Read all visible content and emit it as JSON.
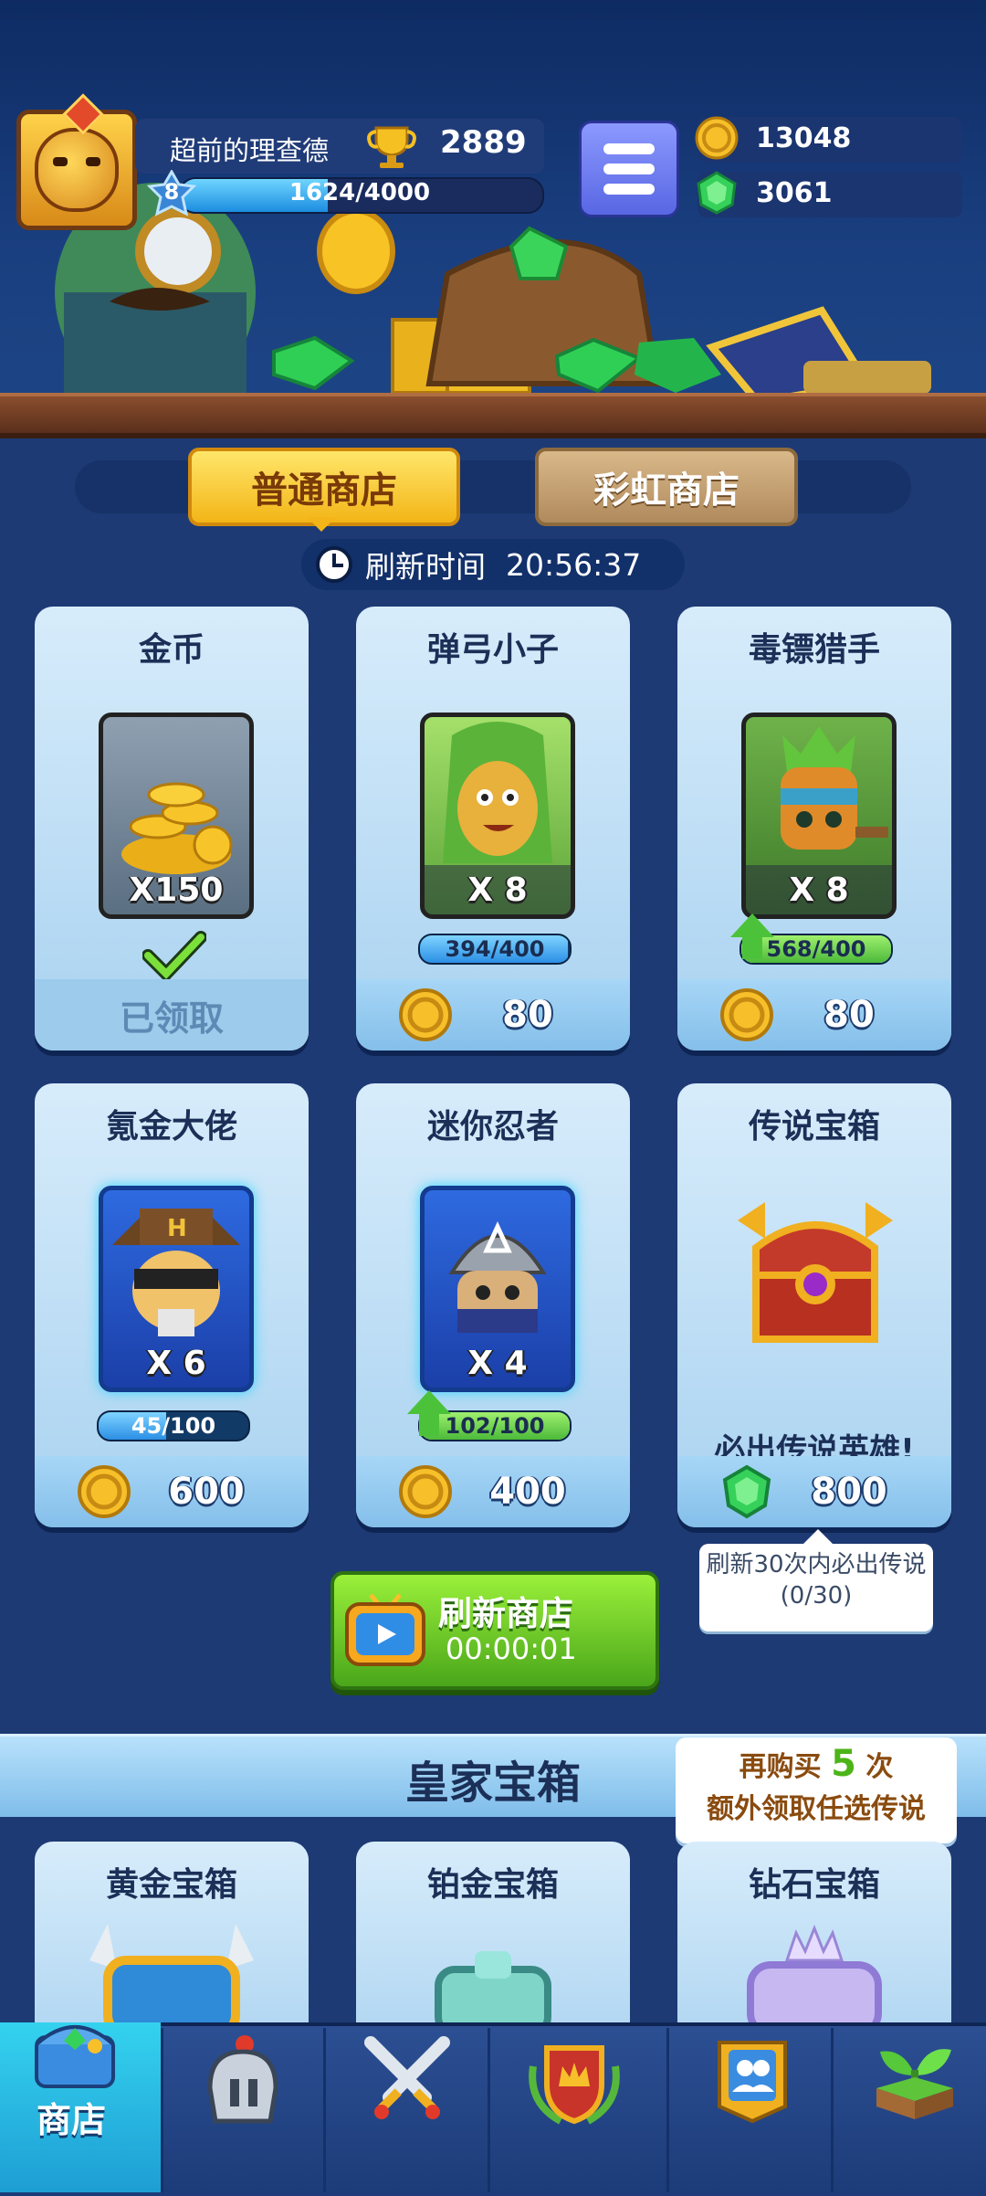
{
  "player": {
    "name": "超前的理查德",
    "trophies": "2889",
    "level": "8",
    "xp_text": "1624/4000",
    "xp_fraction": 0.406
  },
  "currency": {
    "gold": "13048",
    "gems": "3061"
  },
  "tabs": {
    "normal_shop": "普通商店",
    "rainbow_shop": "彩虹商店"
  },
  "refresh": {
    "label": "刷新时间",
    "time": "20:56:37"
  },
  "cards": [
    {
      "title": "金币",
      "qty": "X150",
      "status": "已领取"
    },
    {
      "title": "弹弓小子",
      "qty": "X 8",
      "progress": "394/400",
      "progress_fraction": 0.985,
      "price": "80"
    },
    {
      "title": "毒镖猎手",
      "qty": "X 8",
      "progress": "568/400",
      "progress_fraction": 1.0,
      "price": "80"
    },
    {
      "title": "氪金大佬",
      "qty": "X 6",
      "progress": "45/100",
      "progress_fraction": 0.45,
      "price": "600"
    },
    {
      "title": "迷你忍者",
      "qty": "X 4",
      "progress": "102/100",
      "progress_fraction": 1.0,
      "price": "400"
    },
    {
      "title": "传说宝箱",
      "note": "必出传说英雄!",
      "price": "800"
    }
  ],
  "tooltip": {
    "line1": "刷新30次内必出传说",
    "line2": "(0/30)"
  },
  "refresh_shop": {
    "label": "刷新商店",
    "timer": "00:00:01"
  },
  "royal": {
    "title": "皇家宝箱",
    "bonus_line1_a": "再购买",
    "bonus_count": "5",
    "bonus_line1_b": "次",
    "bonus_line2": "额外领取任选传说",
    "chests": [
      "黄金宝箱",
      "铂金宝箱",
      "钻石宝箱"
    ]
  },
  "nav": {
    "shop": "商店",
    "icons": [
      "shop-chest-icon",
      "knight-helmet-icon",
      "crossed-swords-icon",
      "crown-shield-icon",
      "friends-banner-icon",
      "sprout-island-icon"
    ]
  }
}
